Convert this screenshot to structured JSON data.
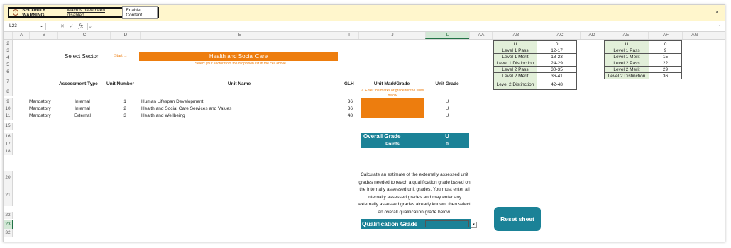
{
  "security": {
    "title": "SECURITY WARNING",
    "message": "Macros have been disabled.",
    "button": "Enable Content",
    "close": "×"
  },
  "formula_bar": {
    "name_box": "L23",
    "fx": "fx"
  },
  "columns": [
    "A",
    "B",
    "C",
    "D",
    "E",
    "I",
    "J",
    "L",
    "AA",
    "AB",
    "AC",
    "AD",
    "AE",
    "AF",
    "AG"
  ],
  "rows": [
    "2",
    "3",
    "4",
    "5",
    "6",
    "7",
    "8",
    "9",
    "10",
    "11",
    "15",
    "16",
    "17",
    "18",
    "20",
    "21",
    "22",
    "23",
    "32"
  ],
  "sheet": {
    "select_sector": "Select Sector",
    "start": "Start →",
    "sector_value": "Health and Social Care",
    "sector_hint": "1. Select your sector from the dropdown list in the cell above",
    "headers": {
      "assessment_type": "Assessment Type",
      "unit_number": "Unit Number",
      "unit_name": "Unit Name",
      "glh": "GLH",
      "unit_mark": "Unit Mark/Grade",
      "unit_grade": "Unit Grade"
    },
    "marks_hint": "2. Enter the marks or grade for the units below",
    "units": [
      {
        "type": "Mandatory",
        "assessment": "Internal",
        "number": "1",
        "name": "Human Lifespan Development",
        "glh": "36",
        "grade": "U"
      },
      {
        "type": "Mandatory",
        "assessment": "Internal",
        "number": "2",
        "name": "Health and Social Care Services and Values",
        "glh": "36",
        "grade": "U"
      },
      {
        "type": "Mandatory",
        "assessment": "External",
        "number": "3",
        "name": "Health and Wellbeing",
        "glh": "48",
        "grade": "U"
      }
    ],
    "overall_grade_label": "Overall Grade",
    "overall_grade_value": "U",
    "points_label": "Points",
    "points_value": "0",
    "calc_text": "Calculate an estimate of the externally assessed unit grades needed to reach a qualification grade based on the internally assessed unit grades. You must enter all internally assessed grades and may enter any externally assessed grades already known, then select an overall qualification grade below.",
    "qualification_grade_label": "Qualification Grade",
    "reset_button": "Reset sheet"
  },
  "lookup_ab": [
    [
      "U",
      "0"
    ],
    [
      "Level 1 Pass",
      "12-17"
    ],
    [
      "Level 1 Merit",
      "18-23"
    ],
    [
      "Level 1 Distinction",
      "24-29"
    ],
    [
      "Level 2 Pass",
      "30-35"
    ],
    [
      "Level 2 Merit",
      "36-41"
    ],
    [
      "Level 2 Distinction",
      "42-48"
    ]
  ],
  "lookup_ae": [
    [
      "U",
      "0"
    ],
    [
      "Level 1 Pass",
      "9"
    ],
    [
      "Level 1 Merit",
      "15"
    ],
    [
      "Level 2 Pass",
      "22"
    ],
    [
      "Level 2 Merit",
      "29"
    ],
    [
      "Level 2 Distinction",
      "36"
    ]
  ]
}
